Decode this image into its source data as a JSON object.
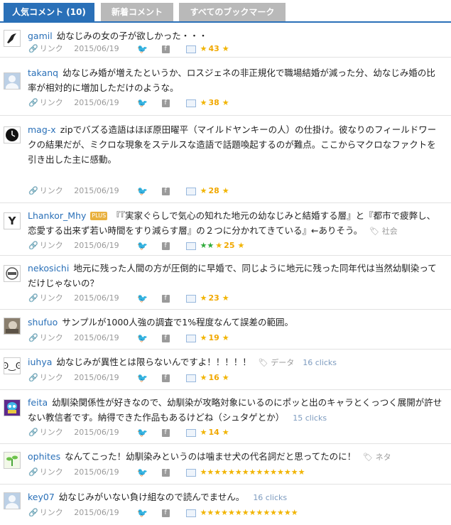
{
  "tabs": [
    "人気コメント (10)",
    "新着コメント",
    "すべてのブックマーク"
  ],
  "link_label": "リンク",
  "comments": [
    {
      "user": "gamil",
      "text": "幼なじみの女の子が欲しかった・・・",
      "date": "2015/06/19",
      "count": "43",
      "avatar_icon": "bird-icon"
    },
    {
      "user": "takanq",
      "text": "幼なじみ婚が増えたというか、ロスジェネの非正規化で職場結婚が減った分、幼なじみ婚の比率が相対的に増加しただけのような。",
      "date": "2015/06/19",
      "count": "38",
      "avatar_icon": "person-silhouette-icon"
    },
    {
      "user": "mag-x",
      "text": "zipでバズる造語はほぼ原田曜平（マイルドヤンキーの人）の仕掛け。彼なりのフィールドワークの結果だが、ミクロな現象をステルスな造語で話題喚起するのが難点。ここからマクロなファクトを引き出した主に感動。",
      "date": "2015/06/19",
      "count": "28",
      "avatar_icon": "clock-icon"
    },
    {
      "user": "Lhankor_Mhy",
      "plus": "PLUS",
      "text": "『『実家ぐらしで気心の知れた地元の幼なじみと結婚する層』と『都市で疲弊し、恋愛する出来ず若い時間をすり減らす層』の２つに分かれてきている』←ありそう。",
      "tag": "社会",
      "date": "2015/06/19",
      "count": "25",
      "avatar_icon": "y-logo-icon"
    },
    {
      "user": "nekosichi",
      "text": "地元に残った人間の方が圧倒的に早婚で、同じように地元に残った同年代は当然幼馴染ってだけじゃないの？",
      "date": "2015/06/19",
      "count": "23",
      "avatar_icon": "badge-icon"
    },
    {
      "user": "shufuo",
      "text": "サンプルが1000人強の調査で1%程度なんて誤差の範囲。",
      "date": "2015/06/19",
      "count": "19",
      "avatar_icon": "photo-icon"
    },
    {
      "user": "iuhya",
      "text": "幼なじみが異性とは限らないんですよ！！！！！",
      "tag": "データ",
      "clicks": "16 clicks",
      "date": "2015/06/19",
      "count": "16",
      "avatar_icon": "face-icon"
    },
    {
      "user": "feita",
      "text": "幼馴染関係性が好きなので、幼馴染が攻略対象にいるのにポッと出のキャラとくっつく展開が許せない教信者です。納得できた作品もあるけどね（シュタゲとか）",
      "clicks": "15 clicks",
      "date": "2015/06/19",
      "count": "14",
      "avatar_icon": "squid-icon"
    },
    {
      "user": "ophites",
      "text": "なんてこった！幼馴染みというのは噛ませ犬の代名詞だと思ってたのに！",
      "tag": "ネタ",
      "date": "2015/06/19",
      "count": "",
      "avatar_icon": "plant-icon"
    },
    {
      "user": "key07",
      "text": "幼なじみがいない負け組なので読んでません。",
      "clicks": "16 clicks",
      "date": "2015/06/19",
      "count": "",
      "avatar_icon": "person-silhouette-icon"
    }
  ]
}
